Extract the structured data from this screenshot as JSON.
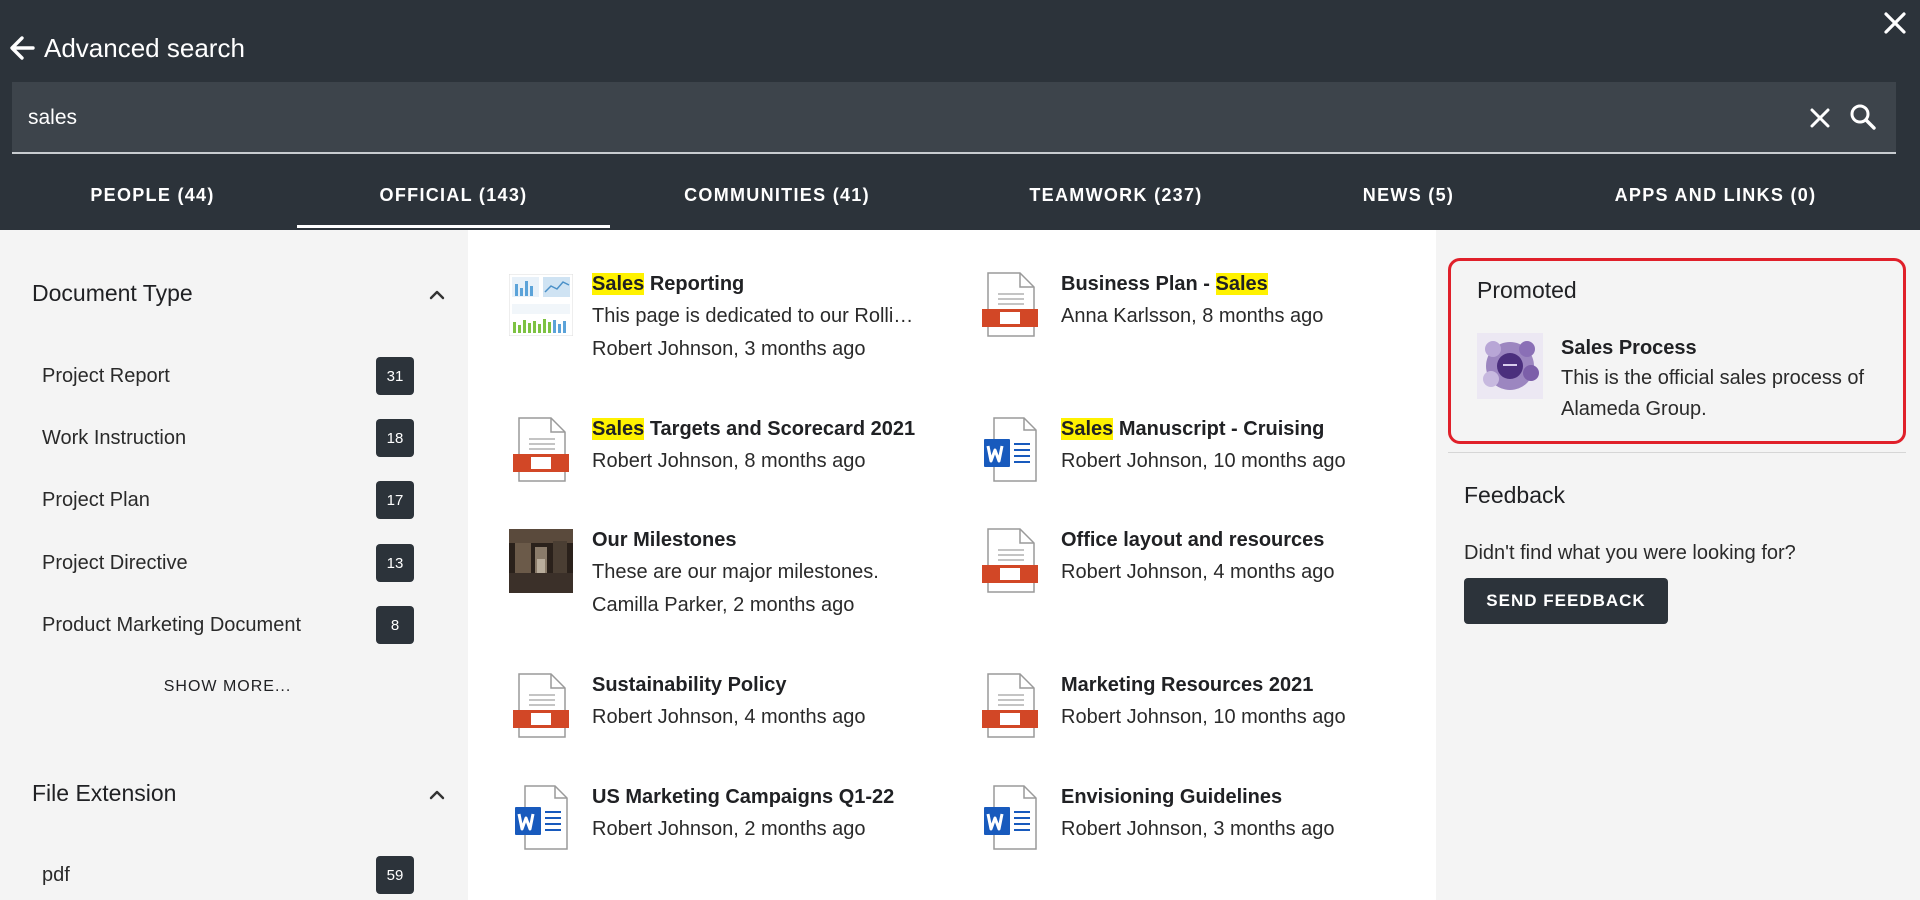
{
  "header": {
    "title": "Advanced search",
    "search_value": "sales"
  },
  "tabs": [
    {
      "label": "PEOPLE (44)"
    },
    {
      "label": "OFFICIAL (143)",
      "active": true
    },
    {
      "label": "COMMUNITIES (41)"
    },
    {
      "label": "TEAMWORK (237)"
    },
    {
      "label": "NEWS (5)"
    },
    {
      "label": "APPS AND LINKS (0)"
    }
  ],
  "sidebar": {
    "document_type": {
      "title": "Document Type",
      "items": [
        {
          "label": "Project Report",
          "count": "31"
        },
        {
          "label": "Work Instruction",
          "count": "18"
        },
        {
          "label": "Project Plan",
          "count": "17"
        },
        {
          "label": "Project Directive",
          "count": "13"
        },
        {
          "label": "Product Marketing Document",
          "count": "8"
        }
      ],
      "show_more": "SHOW MORE..."
    },
    "file_extension": {
      "title": "File Extension",
      "items": [
        {
          "label": "pdf",
          "count": "59"
        }
      ]
    }
  },
  "results": [
    {
      "title_hl": "Sales",
      "title_rest": " Reporting",
      "line1": "This page is dedicated to our Rolli…",
      "line2": "Robert Johnson, 3 months ago",
      "icon": "chart-thumbnail"
    },
    {
      "title_rest": "Business Plan - ",
      "title_hl_end": "Sales",
      "line1": "Anna Karlsson, 8 months ago",
      "icon": "presentation-file-icon"
    },
    {
      "title_hl": "Sales",
      "title_rest": " Targets and Scorecard 2021",
      "line1": "Robert Johnson, 8 months ago",
      "icon": "presentation-file-icon"
    },
    {
      "title_hl": "Sales",
      "title_rest": " Manuscript - Cruising",
      "line1": "Robert Johnson, 10 months ago",
      "icon": "word-file-icon"
    },
    {
      "title_rest": "Our Milestones",
      "line1": "These are our major milestones.",
      "line2": "Camilla Parker, 2 months ago",
      "icon": "photo-thumbnail"
    },
    {
      "title_rest": "Office layout and resources",
      "line1": "Robert Johnson, 4 months ago",
      "icon": "presentation-file-icon"
    },
    {
      "title_rest": "Sustainability Policy",
      "line1": "Robert Johnson, 4 months ago",
      "icon": "presentation-file-icon"
    },
    {
      "title_rest": "Marketing Resources 2021",
      "line1": "Robert Johnson, 10 months ago",
      "icon": "presentation-file-icon"
    },
    {
      "title_rest": "US Marketing Campaigns Q1-22",
      "line1": "Robert Johnson, 2 months ago",
      "icon": "word-file-icon"
    },
    {
      "title_rest": "Envisioning Guidelines",
      "line1": "Robert Johnson, 3 months ago",
      "icon": "word-file-icon"
    }
  ],
  "promoted": {
    "title": "Promoted",
    "item": {
      "name": "Sales Process",
      "desc_line1": "This is the official sales process of",
      "desc_line2": "Alameda Group."
    }
  },
  "feedback": {
    "title": "Feedback",
    "question": "Didn't find what you were looking for?",
    "button": "SEND FEEDBACK"
  },
  "colors": {
    "header_bg": "#2c333a",
    "highlight": "#fff200",
    "promoted_border": "#e0202a",
    "ppt_accent": "#d24726",
    "word_accent": "#185abd"
  }
}
